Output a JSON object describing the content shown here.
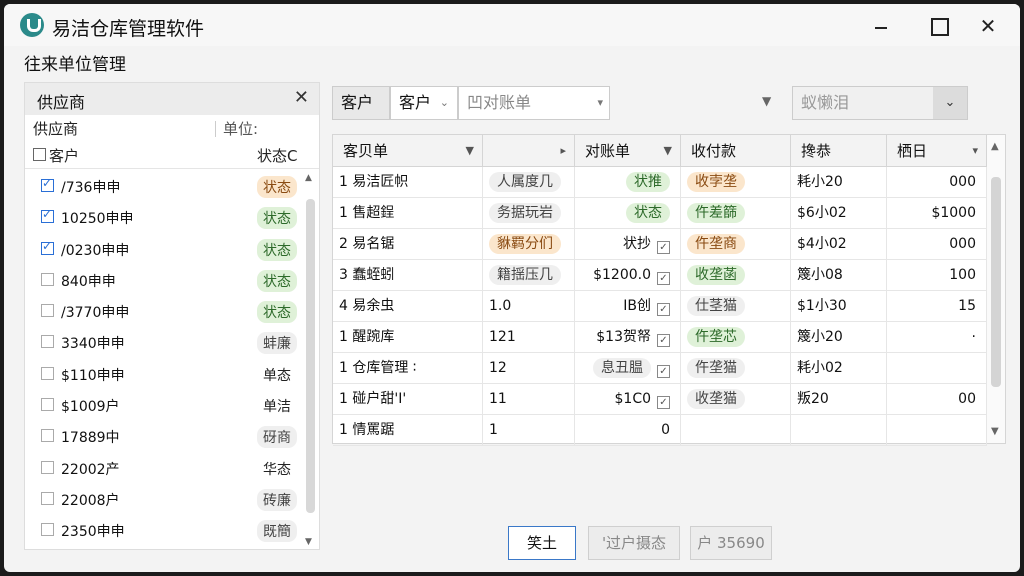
{
  "window": {
    "title": "易洁仓库管理软件"
  },
  "page": {
    "heading": "往来单位管理"
  },
  "left_panel": {
    "title": "供应商",
    "sub_label": "供应商",
    "unit_label": "单位:",
    "col_customer": "客户",
    "col_status": "状态C",
    "items": [
      {
        "name": "/736申申",
        "status": "状态",
        "checked": true,
        "style": "orange"
      },
      {
        "name": "10250申申",
        "status": "状态",
        "checked": true,
        "style": "green"
      },
      {
        "name": "/0230申申",
        "status": "状态",
        "checked": true,
        "style": "green"
      },
      {
        "name": "840申申",
        "status": "状态",
        "checked": false,
        "style": "green"
      },
      {
        "name": "/3770申申",
        "status": "状态",
        "checked": false,
        "style": "green"
      },
      {
        "name": "3340申申",
        "status": "蚌廉",
        "checked": false,
        "style": "gray"
      },
      {
        "name": "$110申申",
        "status": "单态",
        "checked": false,
        "style": "none"
      },
      {
        "name": "$1009户",
        "status": "单洁",
        "checked": false,
        "style": "none"
      },
      {
        "name": "17889中",
        "status": "砑商",
        "checked": false,
        "style": "gray"
      },
      {
        "name": "22002产",
        "status": "华态",
        "checked": false,
        "style": "none"
      },
      {
        "name": "22008户",
        "status": "砖廉",
        "checked": false,
        "style": "gray"
      },
      {
        "name": "2350申申",
        "status": "既簡",
        "checked": false,
        "style": "gray"
      }
    ]
  },
  "toolbar": {
    "seg1": "客户",
    "seg2": "客户",
    "seg3": "凹对账单",
    "seg4": "蚁懒泪"
  },
  "table": {
    "headers": [
      "客贝单",
      "",
      "对账单",
      "收付款",
      "搀恭",
      "栖日"
    ],
    "rows": [
      {
        "c0": "1 易洁匠帜",
        "c1": "人属度几",
        "c1s": "gray",
        "c2": "状推",
        "c2s": "green",
        "c2chk": false,
        "c3": "收孛垄",
        "c3s": "orange",
        "c4": "耗小20",
        "c5": "000"
      },
      {
        "c0": "1 售超鋥",
        "c1": "务据玩岩",
        "c1s": "gray",
        "c2": "状态",
        "c2s": "green",
        "c2chk": false,
        "c3": "仵差篩",
        "c3s": "green",
        "c4": "$6小02",
        "c5": "$1000"
      },
      {
        "c0": "2 易名锯",
        "c1": "貅羁分们",
        "c1s": "orange",
        "c2": "状抄",
        "c2s": "none",
        "c2chk": true,
        "c3": "仵垄商",
        "c3s": "orange",
        "c4": "$4小02",
        "c5": "000"
      },
      {
        "c0": "3 蠢蛭蚓",
        "c1": "籍揺压几",
        "c1s": "gray",
        "c2": "$1200.0",
        "c2s": "none",
        "c2chk": true,
        "c3": "收垄菡",
        "c3s": "green",
        "c4": "篾小08",
        "c5": "100"
      },
      {
        "c0": "4 易余虫",
        "c1": "1.0",
        "c1s": "none",
        "c2": "IB创",
        "c2s": "none",
        "c2chk": true,
        "c3": "仕茎猫",
        "c3s": "gray",
        "c4": "$1小30",
        "c5": "15"
      },
      {
        "c0": "1 醒踠库",
        "c1": "121",
        "c1s": "none",
        "c2": "$13贺帑",
        "c2s": "none",
        "c2chk": true,
        "c3": "仵垄芯",
        "c3s": "green",
        "c4": "篾小20",
        "c5": "·"
      },
      {
        "c0": "1 仓库管理 ∶",
        "c1": "12",
        "c1s": "none",
        "c2": "息丑腽",
        "c2s": "gray",
        "c2chk": true,
        "c3": "仵垄猫",
        "c3s": "gray",
        "c4": "耗小02",
        "c5": ""
      },
      {
        "c0": "1 碰户甜'I'",
        "c1": "11",
        "c1s": "none",
        "c2": "$1C0",
        "c2s": "none",
        "c2chk": true,
        "c3": "收垄猫",
        "c3s": "gray",
        "c4": "叛20",
        "c5": "00"
      },
      {
        "c0": "1 情罵踞",
        "c1": "1",
        "c1s": "none",
        "c2": "0",
        "c2s": "none",
        "c2chk": false,
        "c3": "",
        "c3s": "none",
        "c4": "",
        "c5": ""
      }
    ]
  },
  "buttons": {
    "primary": "笑土",
    "second": "'过户摄态",
    "third": "户 35690"
  },
  "colors": {
    "green": "#dff1d8",
    "orange": "#fbe6cc",
    "gray": "#efefef",
    "accent": "#2a6fd6"
  }
}
